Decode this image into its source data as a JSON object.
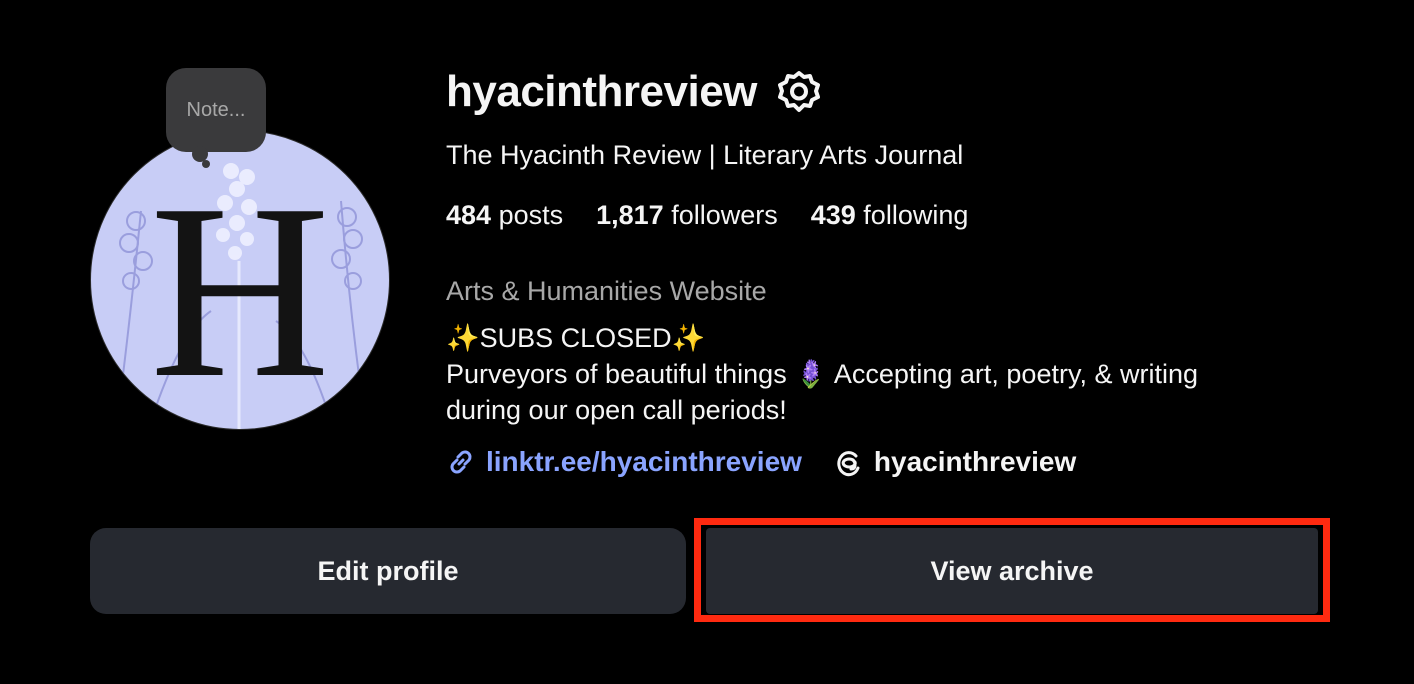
{
  "profile": {
    "note_placeholder": "Note...",
    "username": "hyacinthreview",
    "full_name": "The Hyacinth Review | Literary Arts Journal",
    "stats": {
      "posts_count": "484",
      "posts_label": " posts",
      "followers_count": "1,817",
      "followers_label": " followers",
      "following_count": "439",
      "following_label": " following"
    },
    "category": "Arts & Humanities Website",
    "bio_lines": [
      "✨SUBS CLOSED✨",
      "Purveyors of beautiful things 🪻 Accepting art, poetry, & writing",
      "during our open call periods!"
    ],
    "website_link": "linktr.ee/hyacinthreview",
    "threads_handle": "hyacinthreview"
  },
  "actions": {
    "edit_profile": "Edit profile",
    "view_archive": "View archive"
  },
  "icons": {
    "settings": "gear-icon",
    "link": "link-icon",
    "threads": "threads-icon"
  },
  "colors": {
    "background": "#000000",
    "button": "#262930",
    "link": "#8aa4ff",
    "highlight": "#ff2a10",
    "avatar_bg": "#c8cdf6"
  }
}
